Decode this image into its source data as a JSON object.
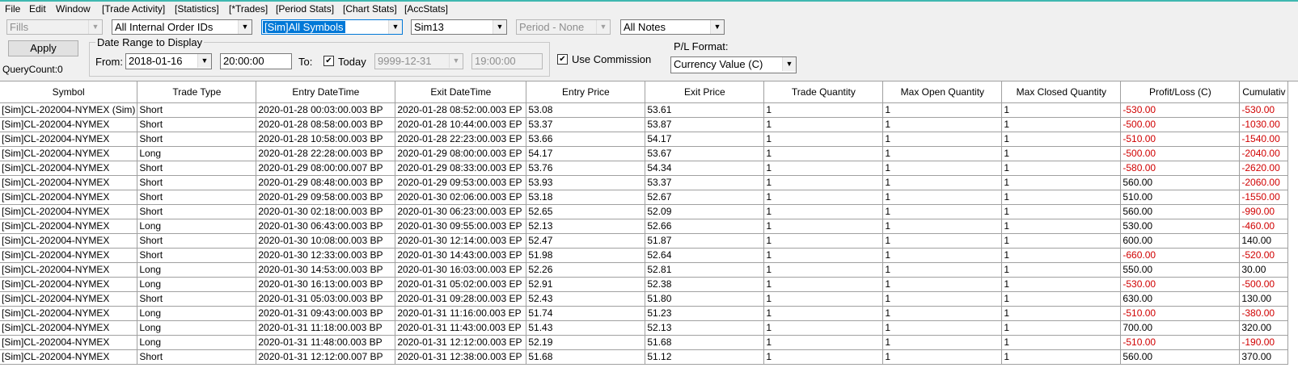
{
  "menu": [
    "File",
    "Edit",
    "Window",
    "[Trade Activity]",
    "[Statistics]",
    "[*Trades]",
    "[Period Stats]",
    "[Chart Stats]",
    "[AccStats]"
  ],
  "filters": {
    "fills": "Fills",
    "order_ids": "All Internal Order IDs",
    "symbols": "[Sim]All Symbols",
    "account": "Sim13",
    "period": "Period - None",
    "notes": "All Notes"
  },
  "apply_label": "Apply",
  "query_count": "QueryCount:0",
  "date_range": {
    "title": "Date Range to Display",
    "from_label": "From:",
    "from_date": "2018-01-16",
    "from_time": "20:00:00",
    "to_label": "To:",
    "today_label": "Today",
    "today_checked": true,
    "to_date": "9999-12-31",
    "to_time": "19:00:00"
  },
  "use_commission_label": "Use Commission",
  "use_commission_checked": true,
  "pl_format_label": "P/L Format:",
  "pl_format_value": "Currency Value (C)",
  "columns": [
    "Symbol",
    "Trade Type",
    "Entry DateTime",
    "Exit DateTime",
    "Entry Price",
    "Exit Price",
    "Trade Quantity",
    "Max Open Quantity",
    "Max Closed Quantity",
    "Profit/Loss (C)",
    "Cumulativ"
  ],
  "rows": [
    [
      "[Sim]CL-202004-NYMEX (Sim)",
      "Short",
      "2020-01-28  00:03:00.003 BP",
      "2020-01-28  08:52:00.003 EP",
      "53.08",
      "53.61",
      "1",
      "1",
      "1",
      "-530.00",
      "-530.00"
    ],
    [
      "[Sim]CL-202004-NYMEX",
      "Short",
      "2020-01-28  08:58:00.003 BP",
      "2020-01-28  10:44:00.003 EP",
      "53.37",
      "53.87",
      "1",
      "1",
      "1",
      "-500.00",
      "-1030.00"
    ],
    [
      "[Sim]CL-202004-NYMEX",
      "Short",
      "2020-01-28  10:58:00.003 BP",
      "2020-01-28  22:23:00.003 EP",
      "53.66",
      "54.17",
      "1",
      "1",
      "1",
      "-510.00",
      "-1540.00"
    ],
    [
      "[Sim]CL-202004-NYMEX",
      "Long",
      "2020-01-28  22:28:00.003 BP",
      "2020-01-29  08:00:00.003 EP",
      "54.17",
      "53.67",
      "1",
      "1",
      "1",
      "-500.00",
      "-2040.00"
    ],
    [
      "[Sim]CL-202004-NYMEX",
      "Short",
      "2020-01-29  08:00:00.007 BP",
      "2020-01-29  08:33:00.003 EP",
      "53.76",
      "54.34",
      "1",
      "1",
      "1",
      "-580.00",
      "-2620.00"
    ],
    [
      "[Sim]CL-202004-NYMEX",
      "Short",
      "2020-01-29  08:48:00.003 BP",
      "2020-01-29  09:53:00.003 EP",
      "53.93",
      "53.37",
      "1",
      "1",
      "1",
      "560.00",
      "-2060.00"
    ],
    [
      "[Sim]CL-202004-NYMEX",
      "Short",
      "2020-01-29  09:58:00.003 BP",
      "2020-01-30  02:06:00.003 EP",
      "53.18",
      "52.67",
      "1",
      "1",
      "1",
      "510.00",
      "-1550.00"
    ],
    [
      "[Sim]CL-202004-NYMEX",
      "Short",
      "2020-01-30  02:18:00.003 BP",
      "2020-01-30  06:23:00.003 EP",
      "52.65",
      "52.09",
      "1",
      "1",
      "1",
      "560.00",
      "-990.00"
    ],
    [
      "[Sim]CL-202004-NYMEX",
      "Long",
      "2020-01-30  06:43:00.003 BP",
      "2020-01-30  09:55:00.003 EP",
      "52.13",
      "52.66",
      "1",
      "1",
      "1",
      "530.00",
      "-460.00"
    ],
    [
      "[Sim]CL-202004-NYMEX",
      "Short",
      "2020-01-30  10:08:00.003 BP",
      "2020-01-30  12:14:00.003 EP",
      "52.47",
      "51.87",
      "1",
      "1",
      "1",
      "600.00",
      "140.00"
    ],
    [
      "[Sim]CL-202004-NYMEX",
      "Short",
      "2020-01-30  12:33:00.003 BP",
      "2020-01-30  14:43:00.003 EP",
      "51.98",
      "52.64",
      "1",
      "1",
      "1",
      "-660.00",
      "-520.00"
    ],
    [
      "[Sim]CL-202004-NYMEX",
      "Long",
      "2020-01-30  14:53:00.003 BP",
      "2020-01-30  16:03:00.003 EP",
      "52.26",
      "52.81",
      "1",
      "1",
      "1",
      "550.00",
      "30.00"
    ],
    [
      "[Sim]CL-202004-NYMEX",
      "Long",
      "2020-01-30  16:13:00.003 BP",
      "2020-01-31  05:02:00.003 EP",
      "52.91",
      "52.38",
      "1",
      "1",
      "1",
      "-530.00",
      "-500.00"
    ],
    [
      "[Sim]CL-202004-NYMEX",
      "Short",
      "2020-01-31  05:03:00.003 BP",
      "2020-01-31  09:28:00.003 EP",
      "52.43",
      "51.80",
      "1",
      "1",
      "1",
      "630.00",
      "130.00"
    ],
    [
      "[Sim]CL-202004-NYMEX",
      "Long",
      "2020-01-31  09:43:00.003 BP",
      "2020-01-31  11:16:00.003 EP",
      "51.74",
      "51.23",
      "1",
      "1",
      "1",
      "-510.00",
      "-380.00"
    ],
    [
      "[Sim]CL-202004-NYMEX",
      "Long",
      "2020-01-31  11:18:00.003 BP",
      "2020-01-31  11:43:00.003 EP",
      "51.43",
      "52.13",
      "1",
      "1",
      "1",
      "700.00",
      "320.00"
    ],
    [
      "[Sim]CL-202004-NYMEX",
      "Long",
      "2020-01-31  11:48:00.003 BP",
      "2020-01-31  12:12:00.003 EP",
      "52.19",
      "51.68",
      "1",
      "1",
      "1",
      "-510.00",
      "-190.00"
    ],
    [
      "[Sim]CL-202004-NYMEX",
      "Short",
      "2020-01-31  12:12:00.007 BP",
      "2020-01-31  12:38:00.003 EP",
      "51.68",
      "51.12",
      "1",
      "1",
      "1",
      "560.00",
      "370.00"
    ]
  ],
  "colors": {
    "negative": "#d00000",
    "selection": "#0078d7",
    "accent_line": "#3fb8b0"
  }
}
